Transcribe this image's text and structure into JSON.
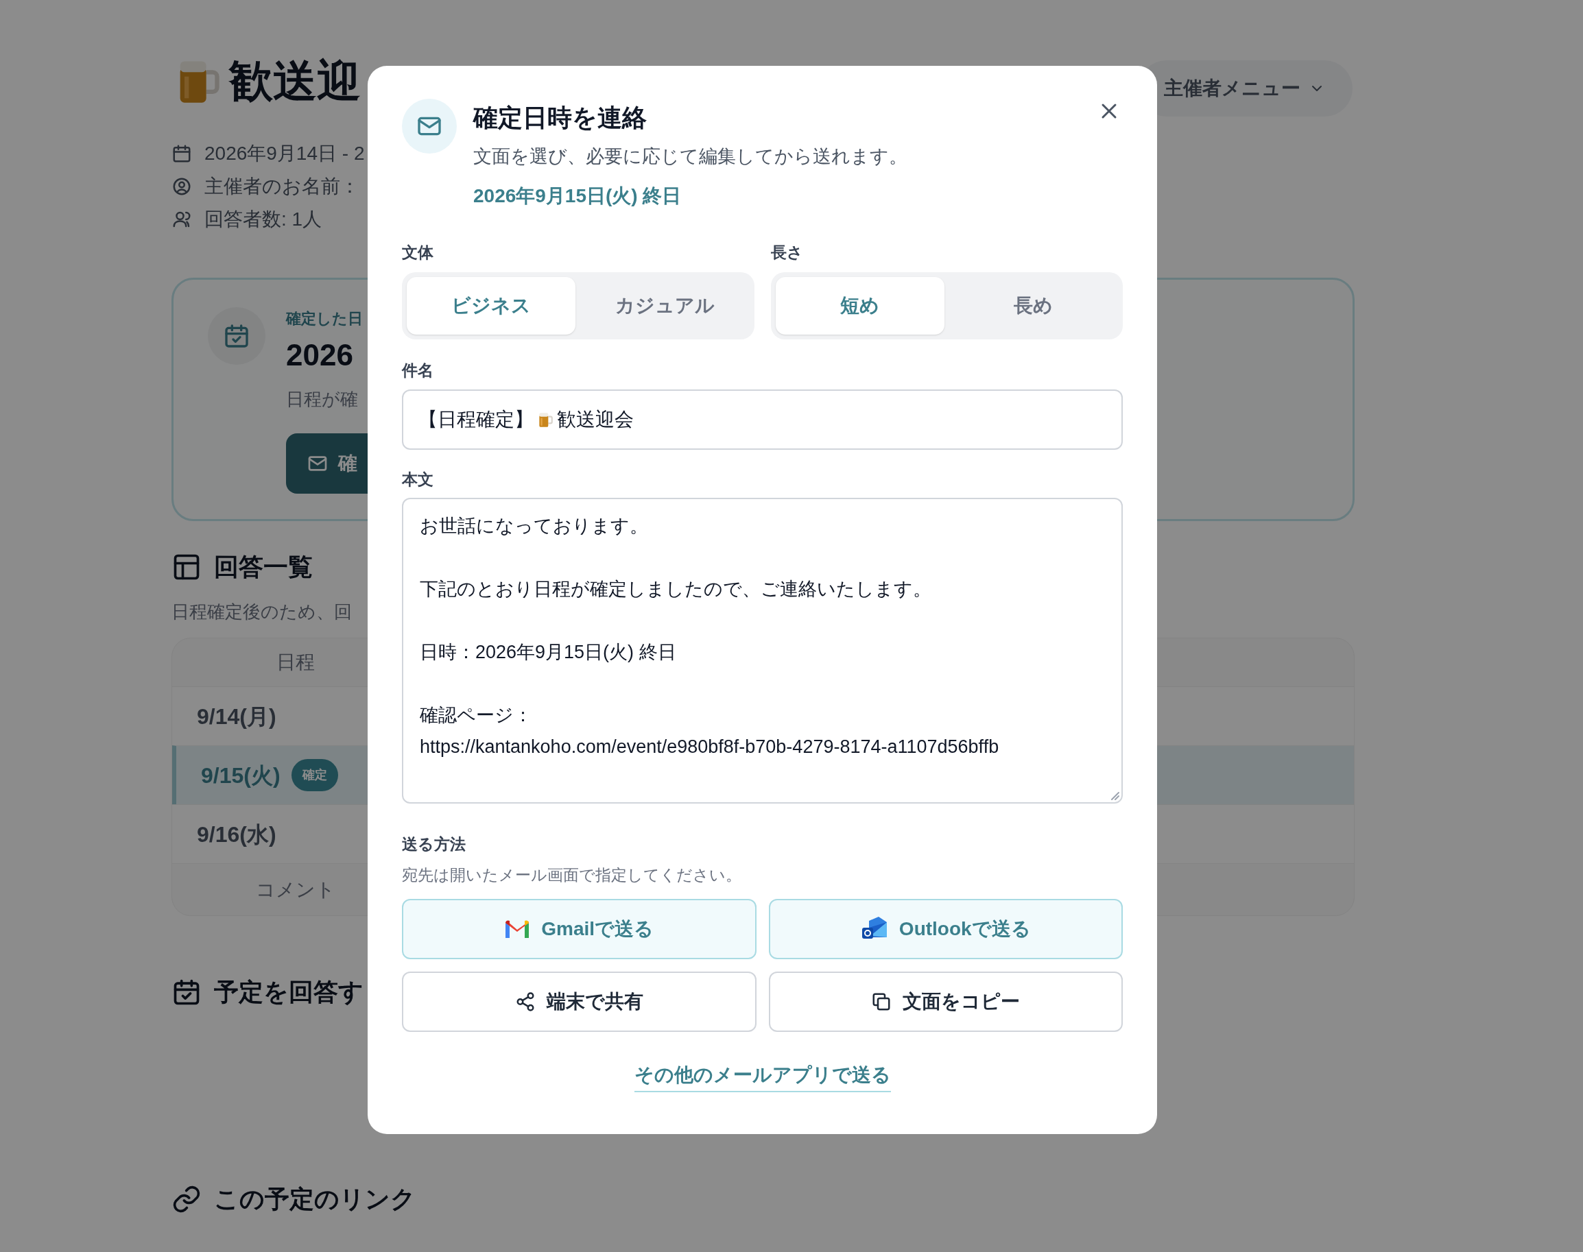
{
  "page": {
    "title": "歓送迎",
    "meta": [
      {
        "kind": "date",
        "text": "2026年9月14日 - 2"
      },
      {
        "kind": "organizer",
        "text": "主催者のお名前："
      },
      {
        "kind": "respondents",
        "text": "回答者数: 1人"
      }
    ],
    "organizer_menu": "主催者メニュー",
    "confirmed_card": {
      "label": "確定した日",
      "date": "2026",
      "note": "日程が確",
      "button": "確"
    },
    "responses": {
      "heading": "回答一覧",
      "note": "日程確定後のため、回",
      "columns": [
        "日程"
      ],
      "rows": [
        {
          "date": "9/14(月)",
          "selected": false
        },
        {
          "date": "9/15(火)",
          "selected": true,
          "badge": "確定"
        },
        {
          "date": "9/16(水)",
          "selected": false
        }
      ],
      "footer": "コメント"
    },
    "answer_heading": "予定を回答す",
    "link_heading": "この予定のリンク"
  },
  "dialog": {
    "title": "確定日時を連絡",
    "subtitle": "文面を選び、必要に応じて編集してから送れます。",
    "date": "2026年9月15日(火) 終日",
    "options": [
      {
        "label": "文体",
        "choices": [
          {
            "label": "ビジネス",
            "selected": true
          },
          {
            "label": "カジュアル",
            "selected": false
          }
        ]
      },
      {
        "label": "長さ",
        "choices": [
          {
            "label": "短め",
            "selected": true
          },
          {
            "label": "長め",
            "selected": false
          }
        ]
      }
    ],
    "subject": {
      "label": "件名",
      "prefix": "【日程確定】",
      "title": "歓送迎会"
    },
    "body": {
      "label": "本文",
      "paragraphs": [
        [
          "お世話になっております。"
        ],
        [
          "下記のとおり日程が確定しましたので、ご連絡いたします。"
        ],
        [
          "日時：2026年9月15日(火) 終日"
        ],
        [
          "確認ページ：",
          "https://kantankoho.com/event/e980bf8f-b70b-4279-8174-a1107d56bffb"
        ]
      ]
    },
    "send": {
      "label": "送る方法",
      "hint": "宛先は開いたメール画面で指定してください。",
      "buttons": [
        {
          "kind": "gmail",
          "label": "Gmailで送る"
        },
        {
          "kind": "outlook",
          "label": "Outlookで送る"
        },
        {
          "kind": "share",
          "label": "端末で共有"
        },
        {
          "kind": "copy",
          "label": "文面をコピー"
        }
      ],
      "link": "その他のメールアプリで送る"
    }
  }
}
